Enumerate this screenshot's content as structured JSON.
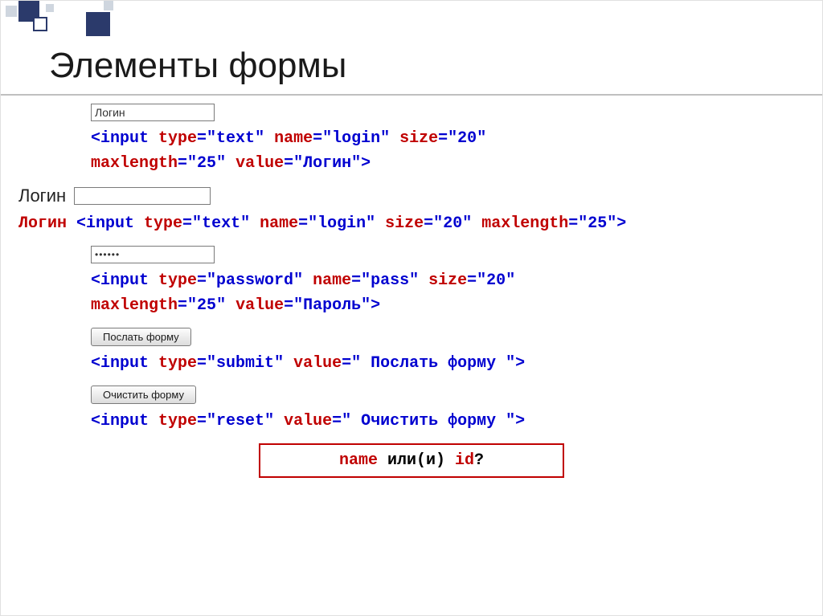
{
  "title": "Элементы формы",
  "ex1": {
    "input_value": "Логин",
    "code_l1_a": "<input ",
    "code_l1_b": "type",
    "code_l1_c": "=\"",
    "code_l1_d": "text",
    "code_l1_e": "\" ",
    "code_l1_f": "name",
    "code_l1_g": "=\"",
    "code_l1_h": "login",
    "code_l1_i": "\" ",
    "code_l1_j": "size",
    "code_l1_k": "=\"",
    "code_l1_l": "20",
    "code_l1_m": "\"",
    "code_l2_a": "maxlength",
    "code_l2_b": "=\"",
    "code_l2_c": "25",
    "code_l2_d": "\" ",
    "code_l2_e": "value",
    "code_l2_f": "=\"",
    "code_l2_g": "Логин",
    "code_l2_h": "\">"
  },
  "ex2": {
    "label": "Логин",
    "code_pre": "Логин ",
    "c1": "<input ",
    "c2": "type",
    "c3": "=\"",
    "c4": "text",
    "c5": "\" ",
    "c6": "name",
    "c7": "=\"",
    "c8": "login",
    "c9": "\" ",
    "c10": "size",
    "c11": "=\"",
    "c12": "20",
    "c13": "\" ",
    "c14": "maxlength",
    "c15": "=\"",
    "c16": "25",
    "c17": "\">"
  },
  "ex3": {
    "dots": "••••••",
    "l1_a": "<input ",
    "l1_b": "type",
    "l1_c": "=\"",
    "l1_d": "password",
    "l1_e": "\" ",
    "l1_f": "name",
    "l1_g": "=\"",
    "l1_h": "pass",
    "l1_i": "\" ",
    "l1_j": "size",
    "l1_k": "=\"",
    "l1_l": "20",
    "l1_m": "\"",
    "l2_a": "maxlength",
    "l2_b": "=\"",
    "l2_c": "25",
    "l2_d": "\" ",
    "l2_e": "value",
    "l2_f": "=\"",
    "l2_g": "Пароль",
    "l2_h": "\">"
  },
  "ex4": {
    "btn_label": "Послать форму",
    "c1": "<input ",
    "c2": "type",
    "c3": "=\"",
    "c4": "submit",
    "c5": "\" ",
    "c6": "value",
    "c7": "=\"",
    "c8": " Послать форму ",
    "c9": "\">"
  },
  "ex5": {
    "btn_label": "Очистить форму",
    "c1": "<input ",
    "c2": "type",
    "c3": "=\"",
    "c4": "reset",
    "c5": "\" ",
    "c6": "value",
    "c7": "=\"",
    "c8": " Очистить форму ",
    "c9": "\">"
  },
  "question": {
    "a": "name",
    "b": " или(и) ",
    "c": "id",
    "d": "?"
  }
}
